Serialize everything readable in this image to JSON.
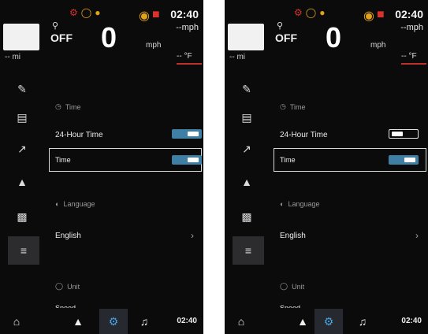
{
  "screens": [
    {
      "status": {
        "clock": "02:40",
        "speed_unit_top": "--mph",
        "cruise": "OFF",
        "speed": "0",
        "speed_unit": "mph",
        "odo": "-- mi",
        "temperature": "-- °F"
      },
      "settings": {
        "time_section": "Time",
        "hour24_label": "24-Hour Time",
        "hour24_state": "on",
        "time_label": "Time",
        "time_state": "on",
        "language_section": "Language",
        "language_value": "English",
        "unit_section": "Unit",
        "speed_label": "Speed"
      },
      "bottombar": {
        "clock": "02:40"
      }
    },
    {
      "status": {
        "clock": "02:40",
        "speed_unit_top": "--mph",
        "cruise": "OFF",
        "speed": "0",
        "speed_unit": "mph",
        "odo": "-- mi",
        "temperature": "-- °F"
      },
      "settings": {
        "time_section": "Time",
        "hour24_label": "24-Hour Time",
        "hour24_state": "off",
        "time_label": "Time",
        "time_state": "on",
        "language_section": "Language",
        "language_value": "English",
        "unit_section": "Unit",
        "speed_label": "Speed"
      },
      "bottombar": {
        "clock": "02:40"
      }
    }
  ],
  "icons": {
    "warnings": [
      "engine-warning-icon",
      "tire-pressure-icon",
      "oil-warning-icon",
      "turtle-mode-icon",
      "battery-icon"
    ],
    "sidebar": [
      "motorcycle-icon",
      "dashboard-icon",
      "bluetooth-pair-icon",
      "volume-icon",
      "display-icon",
      "sliders-icon"
    ],
    "nav": [
      "home-icon",
      "navigation-icon",
      "settings-gear-icon",
      "music-icon"
    ]
  },
  "colors": {
    "accent": "#3e7fa3",
    "nav_active": "#4aa3e0",
    "warning_red": "#d8322a",
    "warning_amber": "#e2a21a",
    "background": "#0b0b0c"
  }
}
